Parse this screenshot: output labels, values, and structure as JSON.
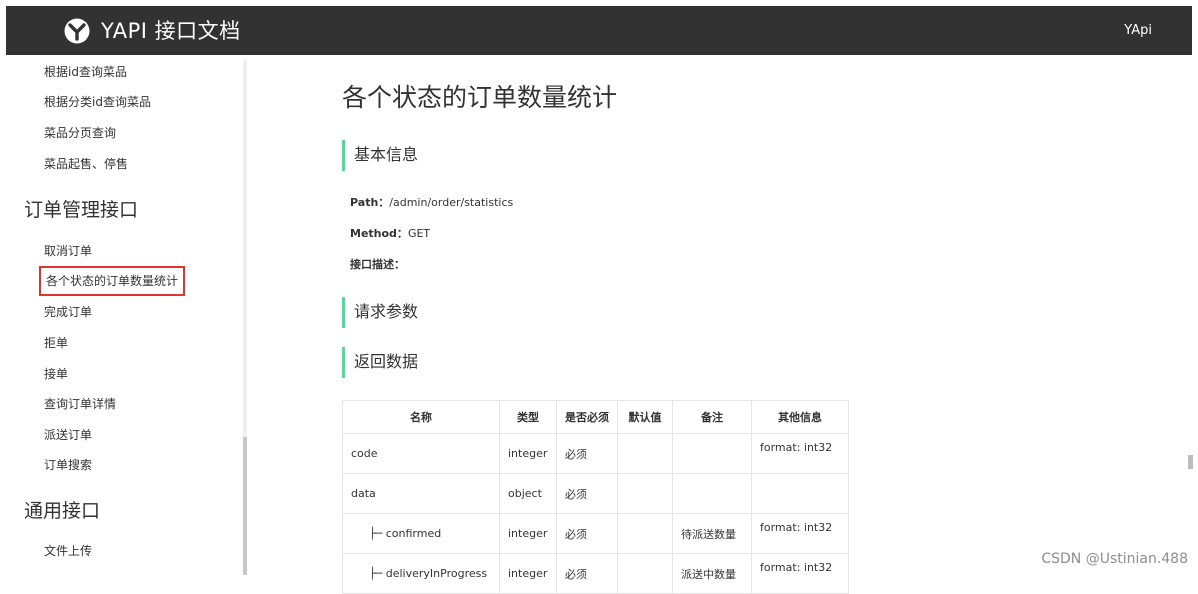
{
  "header": {
    "title": "YAPI 接口文档",
    "brand": "YApi",
    "logo_icon": "yapi-logo-icon"
  },
  "sidebar": {
    "items_top": [
      "根据id查询菜品",
      "根据分类id查询菜品",
      "菜品分页查询",
      "菜品起售、停售"
    ],
    "group_order": "订单管理接口",
    "order_items": [
      "取消订单",
      "各个状态的订单数量统计",
      "完成订单",
      "拒单",
      "接单",
      "查询订单详情",
      "派送订单",
      "订单搜索"
    ],
    "group_common": "通用接口",
    "common_items": [
      "文件上传"
    ]
  },
  "main": {
    "title": "各个状态的订单数量统计",
    "section_basic": "基本信息",
    "path_label": "Path：",
    "path_value": "/admin/order/statistics",
    "method_label": "Method：",
    "method_value": "GET",
    "desc_label": "接口描述：",
    "section_request": "请求参数",
    "section_response": "返回数据",
    "table": {
      "headers": [
        "名称",
        "类型",
        "是否必须",
        "默认值",
        "备注",
        "其他信息"
      ],
      "rows": [
        [
          "code",
          "integer",
          "必须",
          "",
          "",
          "format: int32"
        ],
        [
          "data",
          "object",
          "必须",
          "",
          "",
          ""
        ],
        [
          "├─ confirmed",
          "integer",
          "必须",
          "",
          "待派送数量",
          "format: int32"
        ],
        [
          "├─ deliveryInProgress",
          "integer",
          "必须",
          "",
          "派送中数量",
          "format: int32"
        ]
      ]
    }
  },
  "watermark": "CSDN @Ustinian.488",
  "colors": {
    "header_bg": "#323232",
    "section_accent": "#59d69d",
    "active_border": "#e0342e"
  }
}
